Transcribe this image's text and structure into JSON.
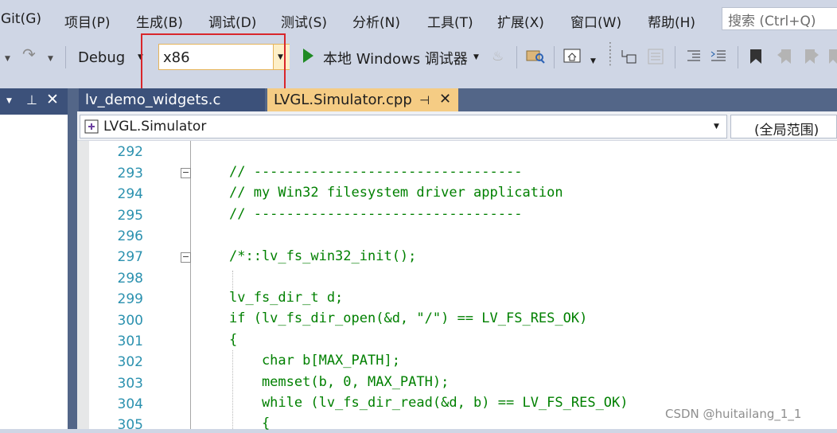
{
  "menubar": {
    "items": [
      "Git(G)",
      "项目(P)",
      "生成(B)",
      "调试(D)",
      "测试(S)",
      "分析(N)",
      "工具(T)",
      "扩展(X)",
      "窗口(W)",
      "帮助(H)"
    ],
    "search_placeholder": "搜索 (Ctrl+Q)"
  },
  "toolbar": {
    "configuration": "Debug",
    "platform": "x86",
    "run_label": "本地 Windows 调试器"
  },
  "tabs": [
    {
      "label": "lv_demo_widgets.c",
      "active": false
    },
    {
      "label": "LVGL.Simulator.cpp",
      "active": true
    }
  ],
  "navbar": {
    "project": "LVGL.Simulator",
    "scope": "(全局范围)"
  },
  "editor": {
    "lines": [
      {
        "num": "292",
        "text": ""
      },
      {
        "num": "293",
        "text": "// ---------------------------------"
      },
      {
        "num": "294",
        "text": "// my Win32 filesystem driver application"
      },
      {
        "num": "295",
        "text": "// ---------------------------------"
      },
      {
        "num": "296",
        "text": ""
      },
      {
        "num": "297",
        "text": "/*::lv_fs_win32_init();"
      },
      {
        "num": "298",
        "text": ""
      },
      {
        "num": "299",
        "text": "lv_fs_dir_t d;"
      },
      {
        "num": "300",
        "text": "if (lv_fs_dir_open(&d, \"/\") == LV_FS_RES_OK)"
      },
      {
        "num": "301",
        "text": "{"
      },
      {
        "num": "302",
        "text": "    char b[MAX_PATH];"
      },
      {
        "num": "303",
        "text": "    memset(b, 0, MAX_PATH);"
      },
      {
        "num": "304",
        "text": "    while (lv_fs_dir_read(&d, b) == LV_FS_RES_OK)"
      },
      {
        "num": "305",
        "text": "    {"
      }
    ]
  },
  "watermark": "CSDN @huitailang_1_1",
  "colors": {
    "comment": "#008000",
    "line_number": "#2b91af",
    "highlight_box": "#d9262b",
    "active_tab": "#f5cc84"
  }
}
